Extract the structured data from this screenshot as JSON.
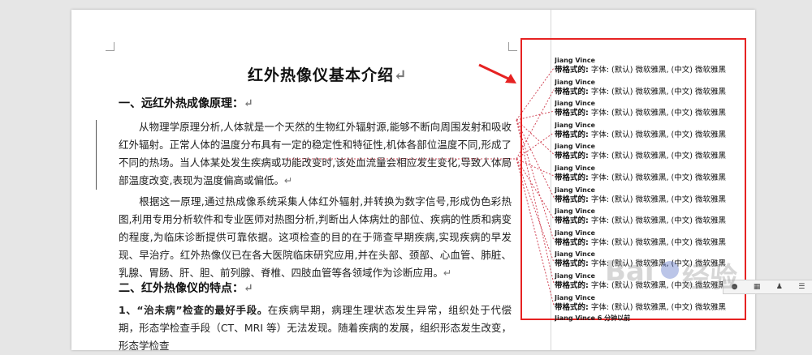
{
  "document": {
    "title": "红外热像仪基本介绍",
    "pilcrow": "↵",
    "section1": {
      "heading": "一、远红外热成像原理：",
      "paragraph1": "从物理学原理分析,人体就是一个天然的生物红外辐射源,能够不断向周围发射和吸收红外辐射。正常人体的温度分布具有一定的稳定性和特征性,机体各部位温度不同,形成了不同的热场。当人体某处发生疾病或功能改变时,该处血流量会相应发生变化,导致人体局部温度改变,表现为温度偏高或偏低。",
      "paragraph2": "根据这一原理,通过热成像系统采集人体红外辐射,并转换为数字信号,形成伪色彩热图,利用专用分析软件和专业医师对热图分析,判断出人体病灶的部位、疾病的性质和病变的程度,为临床诊断提供可靠依据。这项检查的目的在于筛查早期疾病,实现疾病的早发现、早治疗。红外热像仪已在各大医院临床研究应用,并在头部、颈部、心血管、肺脏、乳腺、胃肠、肝、胆、前列腺、脊椎、四肢血管等各领域作为诊断应用。"
    },
    "section2": {
      "heading": "二、红外热像仪的特点：",
      "item1_lead": "1、“治未病”检查的最好手段。",
      "item1_text": "在疾病早期，病理生理状态发生异常，组织处于代偿期，形态学检查手段（CT、MRI 等）无法发现。随着疾病的发展，组织形态发生改变，形态学检查"
    }
  },
  "comments": {
    "author": "Jiang Vince",
    "label": "带格式的:",
    "detail": " 字体: (默认) 微软雅黑, (中文) 微软雅黑",
    "count": 12,
    "last_partial": "Jiang Vince 6 分钟以前"
  },
  "colors": {
    "highlight_box": "#e62222",
    "arrow": "#e62222",
    "leader_lines": "#d24a5a"
  },
  "icons": [
    "callout-arrow-icon",
    "baidu-watermark-paw-icon"
  ],
  "watermark": {
    "text": "Bai",
    "suffix": "经验"
  }
}
